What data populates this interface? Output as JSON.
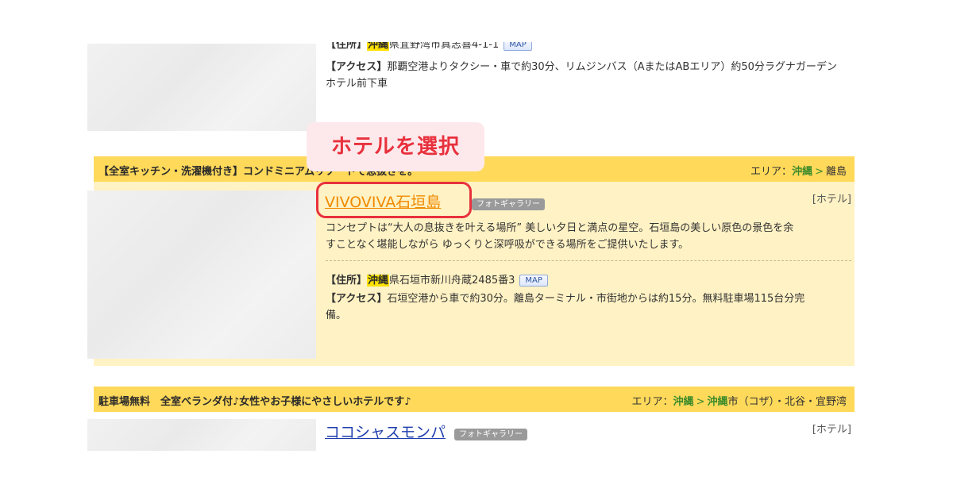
{
  "listing_top": {
    "address_label": "【住所】",
    "address_pref": "沖縄",
    "address_rest": "県宜野湾市真志喜4-1-1",
    "map_label": "MAP",
    "access_label": "【アクセス】",
    "access_text_line1": "那覇空港よりタクシー・車で約30分、リムジンバス（AまたはABエリア）約50分ラグナガーデン",
    "access_text_line2": "ホテル前下車"
  },
  "callout": {
    "text": "ホテルを選択"
  },
  "listing_1": {
    "tagline": "【全室キッチン・洗濯機付き】コンドミニアムリゾートで息抜きを。",
    "area_label": "エリア：",
    "area_pref": "沖縄",
    "area_sep": ">",
    "area_sub": "離島",
    "hotel_name": "VIVOVIVA石垣島",
    "photo_label": "フォトギャラリー",
    "type_label": "[ホテル]",
    "description_line1": "コンセプトは“大人の息抜きを叶える場所” 美しい夕日と満点の星空。石垣島の美しい原色の景色を余",
    "description_line2": "すことなく堪能しながら ゆっくりと深呼吸ができる場所をご提供いたします。",
    "address_label": "【住所】",
    "address_pref": "沖縄",
    "address_rest": "県石垣市新川舟蔵2485番3",
    "map_label": "MAP",
    "access_label": "【アクセス】",
    "access_text_line1": "石垣空港から車で約30分。離島ターミナル・市街地からは約15分。無料駐車場115台分完",
    "access_text_line2": "備。"
  },
  "listing_2": {
    "tagline": "駐車場無料　全室ベランダ付♪女性やお子様にやさしいホテルです♪",
    "area_label": "エリア：",
    "area_pref": "沖縄",
    "area_sep": ">",
    "area_sub_pref": "沖縄",
    "area_sub_rest": "市（コザ）・北谷・宜野湾",
    "hotel_name": "ココシャスモンパ",
    "photo_label": "フォトギャラリー",
    "type_label": "[ホテル]"
  },
  "colors": {
    "header_bar": "#ffd95a",
    "body_box": "#fff2c4",
    "hotel_link_highlighted": "#f08a00",
    "hotel_link": "#1f3fae",
    "callout_text": "#e8313d",
    "callout_bg": "#fde9ec"
  }
}
